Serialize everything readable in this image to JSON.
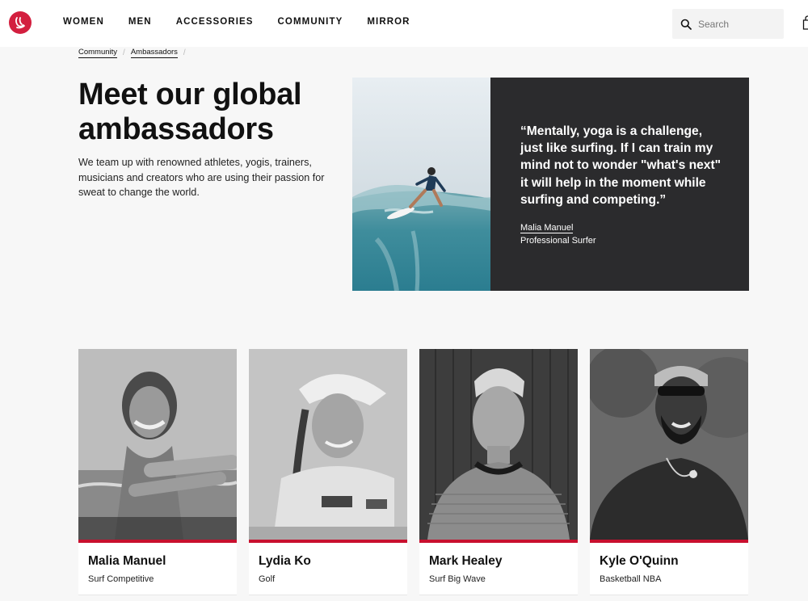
{
  "header": {
    "nav": [
      "WOMEN",
      "MEN",
      "ACCESSORIES",
      "COMMUNITY",
      "MIRROR"
    ],
    "search_placeholder": "Search"
  },
  "breadcrumb": [
    "Community",
    "Ambassadors"
  ],
  "hero": {
    "title_line1": "Meet our global",
    "title_line2": "ambassadors",
    "description": "We team up with renowned athletes, yogis, trainers, musicians and creators who are using their passion for sweat to change the world.",
    "quote": "“Mentally, yoga is a challenge, just like surfing. If I can train my mind not to wonder \"what's next\" it will help in the moment while surfing and competing.”",
    "quote_name": "Malia Manuel",
    "quote_role": "Professional Surfer"
  },
  "ambassadors": [
    {
      "name": "Malia Manuel",
      "sport": "Surf Competitive"
    },
    {
      "name": "Lydia Ko",
      "sport": "Golf"
    },
    {
      "name": "Mark Healey",
      "sport": "Surf Big Wave"
    },
    {
      "name": "Kyle O'Quinn",
      "sport": "Basketball NBA"
    }
  ],
  "colors": {
    "brand_red": "#d31f3f",
    "card_accent": "#c8102e",
    "quote_bg": "#2b2b2d"
  }
}
